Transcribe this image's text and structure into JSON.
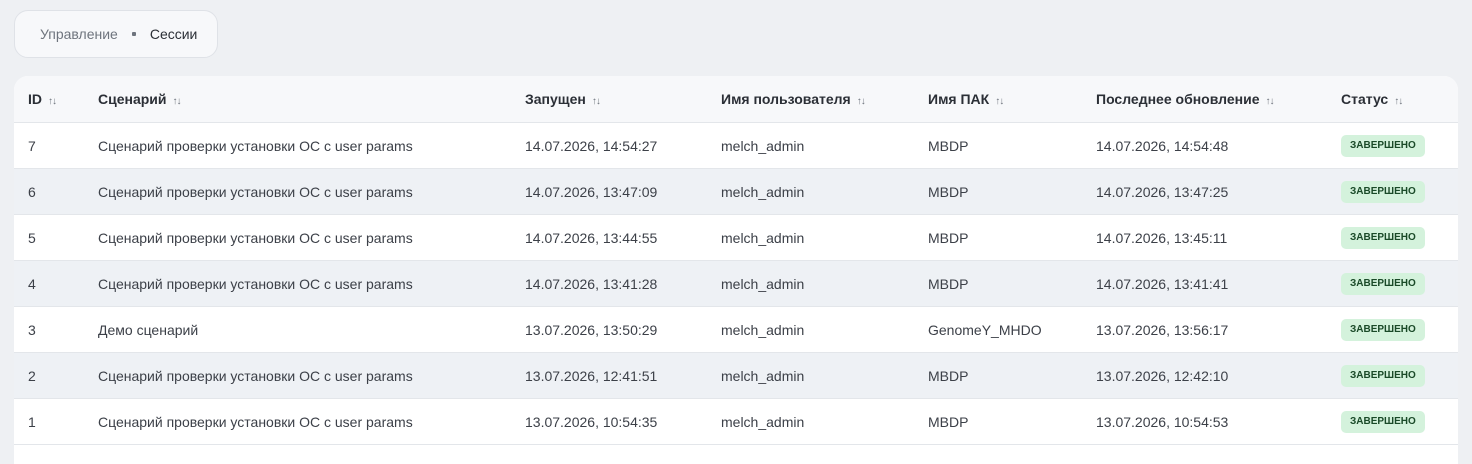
{
  "breadcrumb": {
    "parent": "Управление",
    "current": "Сессии"
  },
  "table": {
    "columns": [
      {
        "key": "id",
        "label": "ID"
      },
      {
        "key": "scenario",
        "label": "Сценарий"
      },
      {
        "key": "started",
        "label": "Запущен"
      },
      {
        "key": "user",
        "label": "Имя пользователя"
      },
      {
        "key": "pak",
        "label": "Имя ПАК"
      },
      {
        "key": "updated",
        "label": "Последнее обновление"
      },
      {
        "key": "status",
        "label": "Статус"
      }
    ],
    "rows": [
      {
        "id": "7",
        "scenario": "Сценарий проверки установки ОС с user params",
        "started": "14.07.2026, 14:54:27",
        "user": "melch_admin",
        "pak": "MBDP",
        "updated": "14.07.2026, 14:54:48",
        "status": "ЗАВЕРШЕНО"
      },
      {
        "id": "6",
        "scenario": "Сценарий проверки установки ОС с user params",
        "started": "14.07.2026, 13:47:09",
        "user": "melch_admin",
        "pak": "MBDP",
        "updated": "14.07.2026, 13:47:25",
        "status": "ЗАВЕРШЕНО"
      },
      {
        "id": "5",
        "scenario": "Сценарий проверки установки ОС с user params",
        "started": "14.07.2026, 13:44:55",
        "user": "melch_admin",
        "pak": "MBDP",
        "updated": "14.07.2026, 13:45:11",
        "status": "ЗАВЕРШЕНО"
      },
      {
        "id": "4",
        "scenario": "Сценарий проверки установки ОС с user params",
        "started": "14.07.2026, 13:41:28",
        "user": "melch_admin",
        "pak": "MBDP",
        "updated": "14.07.2026, 13:41:41",
        "status": "ЗАВЕРШЕНО"
      },
      {
        "id": "3",
        "scenario": "Демо сценарий",
        "started": "13.07.2026, 13:50:29",
        "user": "melch_admin",
        "pak": "GenomeY_MHDO",
        "updated": "13.07.2026, 13:56:17",
        "status": "ЗАВЕРШЕНО"
      },
      {
        "id": "2",
        "scenario": "Сценарий проверки установки ОС с user params",
        "started": "13.07.2026, 12:41:51",
        "user": "melch_admin",
        "pak": "MBDP",
        "updated": "13.07.2026, 12:42:10",
        "status": "ЗАВЕРШЕНО"
      },
      {
        "id": "1",
        "scenario": "Сценарий проверки установки ОС с user params",
        "started": "13.07.2026, 10:54:35",
        "user": "melch_admin",
        "pak": "MBDP",
        "updated": "13.07.2026, 10:54:53",
        "status": "ЗАВЕРШЕНО"
      }
    ]
  },
  "icons": {
    "sort": "sort-arrows-icon"
  },
  "colors": {
    "status_completed_bg": "#d4f2dc",
    "status_completed_text": "#1a4a28",
    "row_alt_bg": "#eef1f5"
  }
}
